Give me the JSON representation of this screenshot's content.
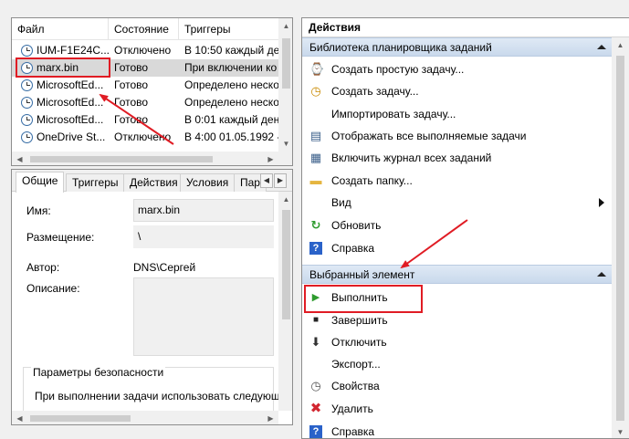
{
  "task_list": {
    "columns": [
      "Файл",
      "Состояние",
      "Триггеры"
    ],
    "rows": [
      {
        "name": "IUM-F1E24C...",
        "state": "Отключено",
        "trigger": "В 10:50 каждый ден"
      },
      {
        "name": "marx.bin",
        "state": "Готово",
        "trigger": "При включении ко"
      },
      {
        "name": "MicrosoftEd...",
        "state": "Готово",
        "trigger": "Определено неско"
      },
      {
        "name": "MicrosoftEd...",
        "state": "Готово",
        "trigger": "Определено неско"
      },
      {
        "name": "MicrosoftEd...",
        "state": "Готово",
        "trigger": "В 0:01 каждый день"
      },
      {
        "name": "OneDrive St...",
        "state": "Отключено",
        "trigger": "В 4:00 01.05.1992 - к"
      }
    ],
    "selected_row": 1
  },
  "details": {
    "tabs": [
      "Общие",
      "Триггеры",
      "Действия",
      "Условия",
      "Пар"
    ],
    "fields": {
      "name_label": "Имя:",
      "name_value": "marx.bin",
      "location_label": "Размещение:",
      "location_value": "\\",
      "author_label": "Автор:",
      "author_value": "DNS\\Сергей",
      "description_label": "Описание:"
    },
    "security_title": "Параметры безопасности",
    "security_text": "При выполнении задачи использовать следующ"
  },
  "actions": {
    "title": "Действия",
    "library_group": {
      "title": "Библиотека планировщика заданий",
      "items": [
        {
          "label": "Создать простую задачу...",
          "icon": "create-basic-task-icon",
          "glyph": "⌚"
        },
        {
          "label": "Создать задачу...",
          "icon": "create-task-icon",
          "glyph": "◷"
        },
        {
          "label": "Импортировать задачу...",
          "icon": "",
          "glyph": ""
        },
        {
          "label": "Отображать все выполняемые задачи",
          "icon": "running-tasks-icon",
          "glyph": "▤"
        },
        {
          "label": "Включить журнал всех заданий",
          "icon": "history-icon",
          "glyph": "▦"
        },
        {
          "label": "Создать папку...",
          "icon": "new-folder-icon",
          "glyph": "▬"
        },
        {
          "label": "Вид",
          "icon": "",
          "glyph": ""
        },
        {
          "label": "Обновить",
          "icon": "refresh-icon",
          "glyph": "↻"
        },
        {
          "label": "Справка",
          "icon": "help-icon",
          "glyph": "?"
        }
      ]
    },
    "selected_group": {
      "title": "Выбранный элемент",
      "items": [
        {
          "label": "Выполнить",
          "icon": "run-icon",
          "glyph": "▶"
        },
        {
          "label": "Завершить",
          "icon": "end-icon",
          "glyph": "■"
        },
        {
          "label": "Отключить",
          "icon": "disable-icon",
          "glyph": "⬇"
        },
        {
          "label": "Экспорт...",
          "icon": "",
          "glyph": ""
        },
        {
          "label": "Свойства",
          "icon": "properties-icon",
          "glyph": "◷"
        },
        {
          "label": "Удалить",
          "icon": "delete-icon",
          "glyph": "✖"
        },
        {
          "label": "Справка",
          "icon": "help-icon",
          "glyph": "?"
        }
      ]
    }
  },
  "colors": {
    "highlight_red": "#e01c24",
    "group_header": "#c9d9ec",
    "selected_row": "#d9d9d9",
    "run_green": "#2e9b2e",
    "delete_red": "#d22630",
    "help_blue": "#2a62c9"
  }
}
